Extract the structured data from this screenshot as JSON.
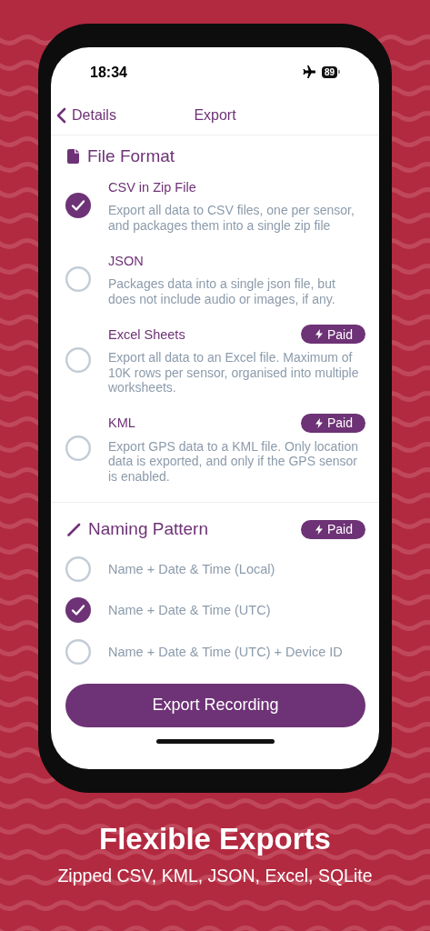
{
  "status_bar": {
    "time": "18:34",
    "battery": "89"
  },
  "nav": {
    "back_label": "Details",
    "title": "Export"
  },
  "file_format": {
    "title": "File Format",
    "options": [
      {
        "title": "CSV in Zip File",
        "description": "Export all data to CSV files, one per sensor, and packages them into a single zip file",
        "selected": true
      },
      {
        "title": "JSON",
        "description": "Packages data into a single json file, but does not include audio or images, if any.",
        "selected": false
      },
      {
        "title": "Excel Sheets",
        "badge": "Paid",
        "description": "Export all data to an Excel file. Maximum of 10K rows per sensor, organised into multiple worksheets.",
        "selected": false
      },
      {
        "title": "KML",
        "badge": "Paid",
        "description": "Export GPS data to a KML file. Only location data is exported, and only if the GPS sensor is enabled.",
        "selected": false
      }
    ]
  },
  "naming_pattern": {
    "title": "Naming Pattern",
    "badge": "Paid",
    "options": [
      {
        "label": "Name + Date & Time (Local)",
        "selected": false
      },
      {
        "label": "Name + Date & Time (UTC)",
        "selected": true
      },
      {
        "label": "Name + Date & Time (UTC) + Device ID",
        "selected": false
      }
    ]
  },
  "export_button": "Export Recording",
  "caption": {
    "title": "Flexible Exports",
    "subtitle": "Zipped CSV, KML, JSON, Excel, SQLite"
  }
}
